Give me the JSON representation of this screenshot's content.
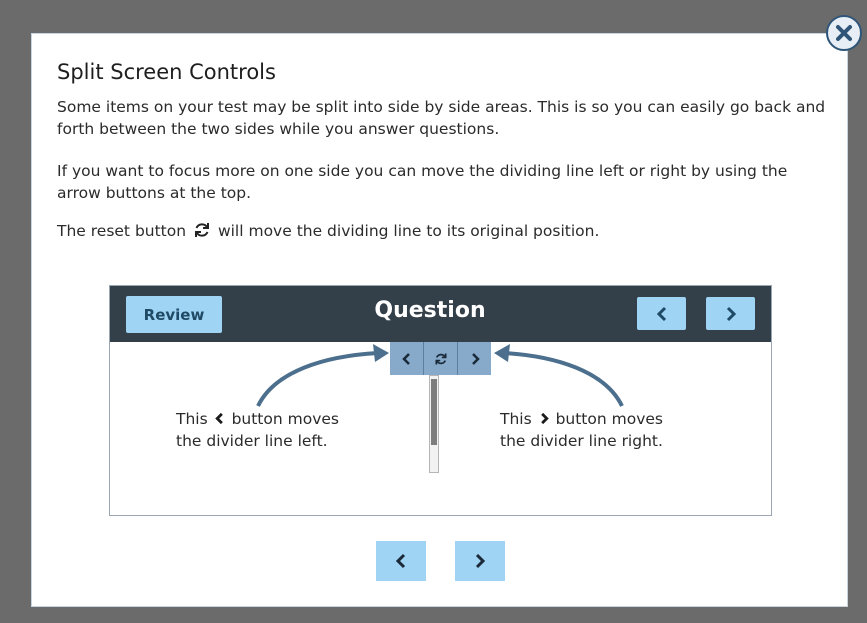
{
  "dialog": {
    "title": "Split Screen Controls",
    "paragraph_1": "Some items on your test may be split into side by side areas. This is so you can easily go back and forth between the two sides while you answer questions.",
    "paragraph_2": "If you want to focus more on one side you can move the dividing line left or right by using the arrow buttons at the top.",
    "paragraph_3_before": "The reset button",
    "paragraph_3_after": "will move the dividing line to its original position."
  },
  "demo": {
    "review_label": "Review",
    "header_title": "Question",
    "left_caption_pre": "This",
    "left_caption_post": "button moves",
    "left_caption_line2": "the divider line left.",
    "right_caption_pre": "This",
    "right_caption_post": "button moves",
    "right_caption_line2": "the divider line right."
  },
  "colors": {
    "overlay": "#6b6b6b",
    "header": "#333f49",
    "button_light_blue": "#9fd4f5",
    "divider_control": "#87aacb",
    "arrow_stroke": "#4b6f8d",
    "close_border": "#2f5578"
  },
  "icons": {
    "close": "close-icon",
    "reset": "reset-icon",
    "left": "chevron-left-icon",
    "right": "chevron-right-icon"
  }
}
